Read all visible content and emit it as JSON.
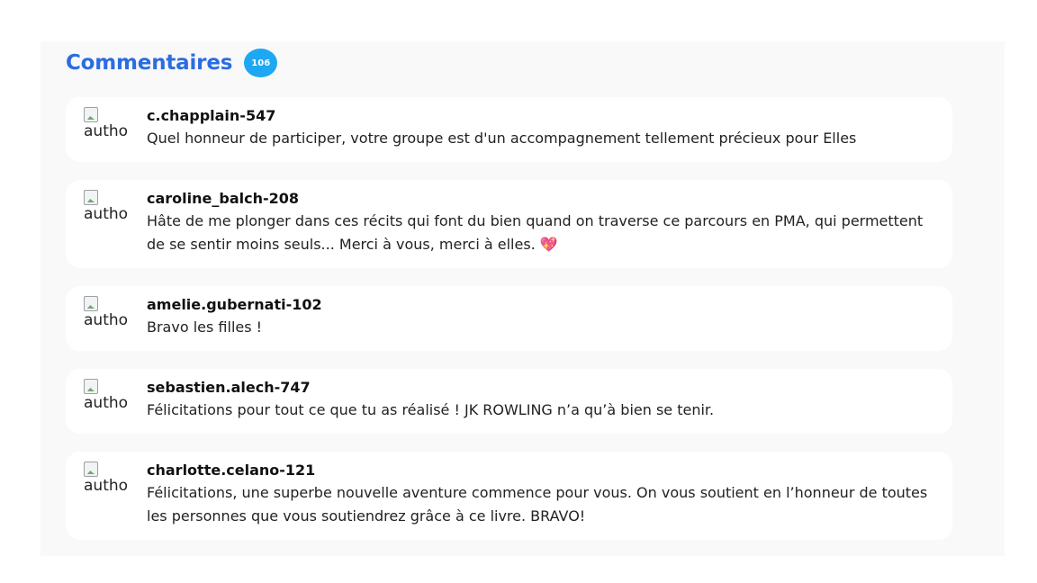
{
  "comments_section": {
    "title": "Commentaires",
    "count": "106",
    "avatar_alt": "autho",
    "items": [
      {
        "username": "c.chapplain-547",
        "text": "Quel honneur de participer, votre groupe est d'un accompagnement tellement précieux pour Elles"
      },
      {
        "username": "caroline_balch-208",
        "text": "Hâte de me plonger dans ces récits qui font du bien quand on traverse ce parcours en PMA, qui permettent de se sentir moins seuls... Merci à vous, merci à elles.",
        "emoji": "💖"
      },
      {
        "username": "amelie.gubernati-102",
        "text": "Bravo les filles !"
      },
      {
        "username": "sebastien.alech-747",
        "text": "Félicitations pour tout ce que tu as réalisé ! JK ROWLING n’a qu’à bien se tenir."
      },
      {
        "username": "charlotte.celano-121",
        "text": "Félicitations, une superbe nouvelle aventure commence pour vous. On vous soutient en l’honneur de toutes les personnes que vous soutiendrez grâce à ce livre. BRAVO!"
      }
    ]
  }
}
